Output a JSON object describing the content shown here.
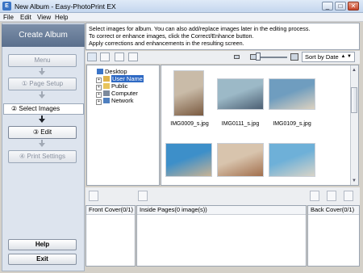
{
  "window": {
    "title": "New Album - Easy-PhotoPrint EX",
    "min": "_",
    "max": "□",
    "close": "✕"
  },
  "menu": [
    "File",
    "Edit",
    "View",
    "Help"
  ],
  "sidebar": {
    "header": "Create Album",
    "steps": [
      {
        "label": "Menu"
      },
      {
        "label": "① Page Setup"
      },
      {
        "label": "② Select Images"
      },
      {
        "label": "③ Edit"
      },
      {
        "label": "④ Print Settings"
      }
    ],
    "help": "Help",
    "exit": "Exit"
  },
  "instructions": {
    "line1": "Select images for album. You can also add/replace images later in the editing process.",
    "line2": "To correct or enhance images, click the Correct/Enhance button.",
    "line3": "Apply corrections and enhancements in the resulting screen."
  },
  "toolbar": {
    "sort_value": "Sort by Date",
    "sort_arrows": "▲ ▼"
  },
  "tree": {
    "root": "Desktop",
    "items": [
      "User Name",
      "Public",
      "Computer",
      "Network"
    ]
  },
  "thumbnails": [
    {
      "caption": "IMG0009_s.jpg",
      "colors": [
        "#c9bba8",
        "#7a5a40"
      ]
    },
    {
      "caption": "IMG0111_s.jpg",
      "colors": [
        "#9cb9c7",
        "#4c5f73"
      ]
    },
    {
      "caption": "IMG0109_s.jpg",
      "colors": [
        "#6f9dbf",
        "#ddd2c0"
      ]
    },
    {
      "caption": "",
      "colors": [
        "#3d8fc9",
        "#c9b394"
      ]
    },
    {
      "caption": "",
      "colors": [
        "#d8c4ad",
        "#a26f4d"
      ]
    },
    {
      "caption": "",
      "colors": [
        "#6eb0d8",
        "#d9d4c8"
      ]
    }
  ],
  "album": {
    "front_cover": "Front Cover(0/1)",
    "inside_pages": "Inside Pages(0 image(s))",
    "back_cover": "Back Cover(0/1)"
  }
}
